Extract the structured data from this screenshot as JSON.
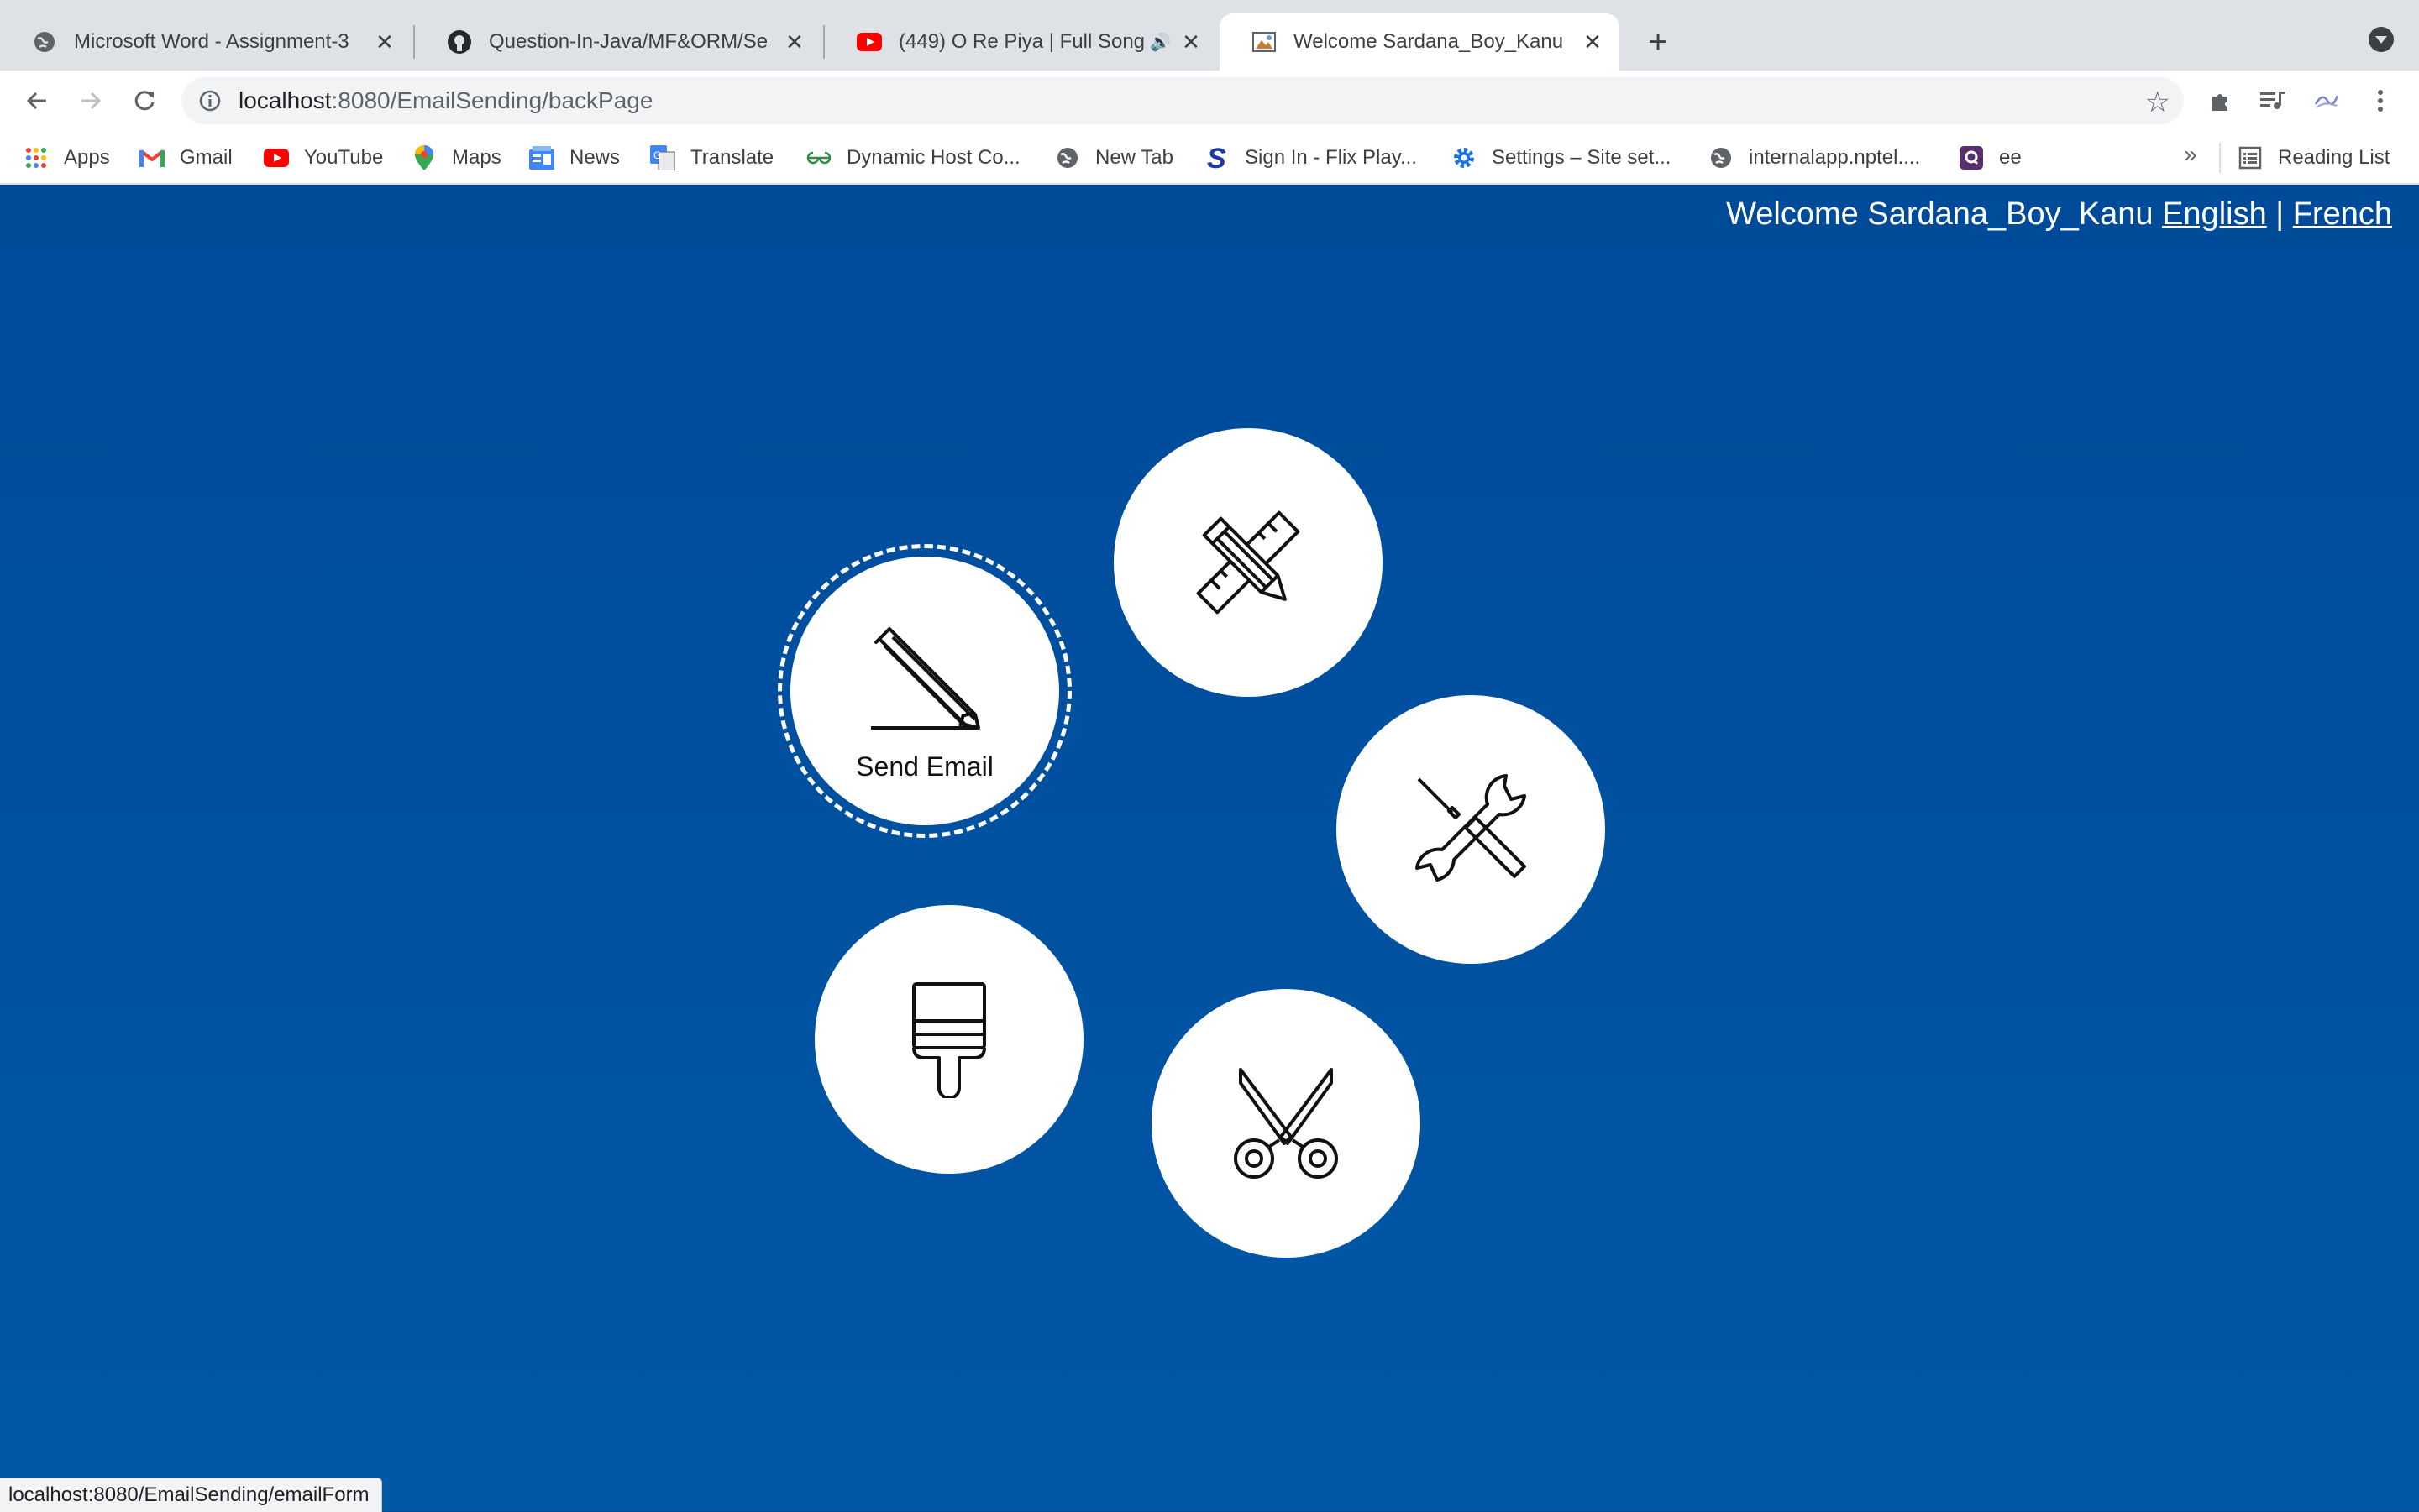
{
  "browser": {
    "tabs": [
      {
        "title": "Microsoft Word - Assignment-3",
        "icon": "globe-icon",
        "active": false
      },
      {
        "title": "Question-In-Java/MF&ORM/Se",
        "icon": "github-icon",
        "active": false
      },
      {
        "title": "(449) O Re Piya | Full Song",
        "icon": "youtube-icon",
        "active": false,
        "audio": true
      },
      {
        "title": "Welcome Sardana_Boy_Kanu",
        "icon": "image-icon",
        "active": true
      }
    ],
    "address": {
      "host": "localhost",
      "path": ":8080/EmailSending/backPage"
    },
    "bookmarks": [
      {
        "label": "Apps",
        "icon": "apps-grid-icon"
      },
      {
        "label": "Gmail",
        "icon": "gmail-icon"
      },
      {
        "label": "YouTube",
        "icon": "youtube-icon"
      },
      {
        "label": "Maps",
        "icon": "maps-pin-icon"
      },
      {
        "label": "News",
        "icon": "news-icon"
      },
      {
        "label": "Translate",
        "icon": "translate-icon"
      },
      {
        "label": "Dynamic Host Co...",
        "icon": "gfg-icon"
      },
      {
        "label": "New Tab",
        "icon": "globe-icon"
      },
      {
        "label": "Sign In - Flix Play...",
        "icon": "flix-s-icon"
      },
      {
        "label": "Settings – Site set...",
        "icon": "gear-icon"
      },
      {
        "label": "internalapp.nptel....",
        "icon": "globe-icon"
      },
      {
        "label": "ee",
        "icon": "purple-square-icon"
      }
    ],
    "reading_list_label": "Reading List",
    "more_label": "»",
    "status_url": "localhost:8080/EmailSending/emailForm"
  },
  "page": {
    "welcome_text": "Welcome Sardana_Boy_Kanu",
    "lang_english": "English",
    "lang_separator": "|",
    "lang_french": "French",
    "send_email_label": "Send Email"
  },
  "colors": {
    "page_background": "#004a9a",
    "circle_fill": "#ffffff",
    "tabstrip": "#dee1e6"
  }
}
